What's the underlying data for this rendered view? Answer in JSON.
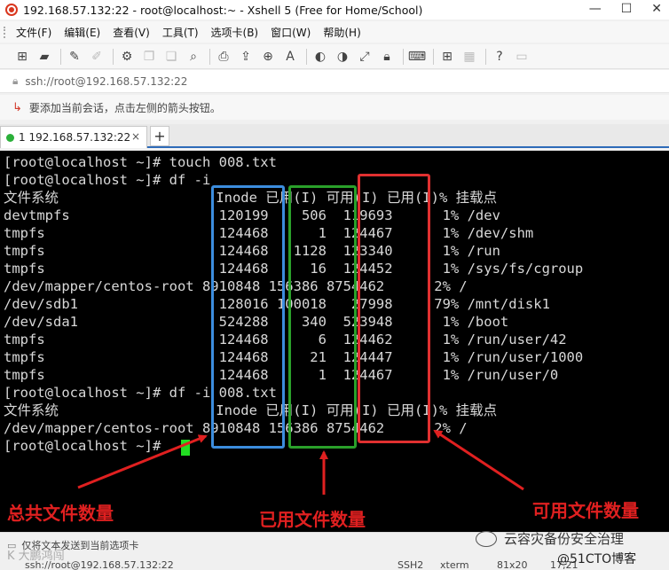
{
  "window": {
    "title": "192.168.57.132:22 - root@localhost:~ - Xshell 5 (Free for Home/School)",
    "controls": [
      "—",
      "☐",
      "✕"
    ]
  },
  "menu": [
    "文件(F)",
    "编辑(E)",
    "查看(V)",
    "工具(T)",
    "选项卡(B)",
    "窗口(W)",
    "帮助(H)"
  ],
  "address": "ssh://root@192.168.57.132:22",
  "hint": "要添加当前会话，点击左侧的箭头按钮。",
  "tab": {
    "label": "1 192.168.57.132:22",
    "close": "×",
    "new": "+"
  },
  "terminal_lines": [
    "[root@localhost ~]# touch 008.txt",
    "[root@localhost ~]# df -i",
    "文件系统                   Inode 已用(I) 可用(I) 已用(I)% 挂载点",
    "devtmpfs                  120199    506  119693      1% /dev",
    "tmpfs                     124468      1  124467      1% /dev/shm",
    "tmpfs                     124468   1128  123340      1% /run",
    "tmpfs                     124468     16  124452      1% /sys/fs/cgroup",
    "/dev/mapper/centos-root 8910848 156386 8754462      2% /",
    "/dev/sdb1                 128016 100018   27998     79% /mnt/disk1",
    "/dev/sda1                 524288    340  523948      1% /boot",
    "tmpfs                     124468      6  124462      1% /run/user/42",
    "tmpfs                     124468     21  124447      1% /run/user/1000",
    "tmpfs                     124468      1  124467      1% /run/user/0",
    "[root@localhost ~]# df -i 008.txt",
    "文件系统                   Inode 已用(I) 可用(I) 已用(I)% 挂载点",
    "/dev/mapper/centos-root 8910848 156386 8754462      2% /",
    "[root@localhost ~]# "
  ],
  "annotations": {
    "total": "总共文件数量",
    "used": "已用文件数量",
    "available": "可用文件数量"
  },
  "status": {
    "send_text": "仅将文本发送到当前选项卡",
    "connection": "ssh://root@192.168.57.132:22",
    "protocol": "SSH2",
    "term": "xterm",
    "size": "81x20",
    "pos": "17,21"
  },
  "watermarks": {
    "wechat": "云容灾备份安全治理",
    "blog": "@51CTO博客",
    "bottom_left": "K 大鹏鸿闯"
  }
}
